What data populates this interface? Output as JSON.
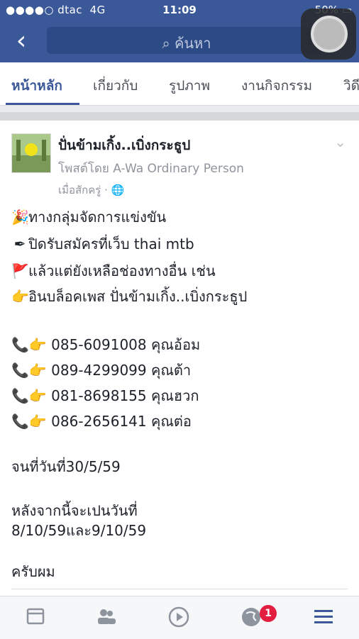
{
  "status_bar": {
    "carrier": "●●●●○ dtac",
    "network": "4G",
    "time": "11:09",
    "battery": "50%"
  },
  "header": {
    "search_placeholder": "ค้นหา",
    "back_label": "‹"
  },
  "tabs": [
    {
      "label": "หน้าหลัก",
      "active": true
    },
    {
      "label": "เกี่ยวกับ"
    },
    {
      "label": "รูปภาพ"
    },
    {
      "label": "งานกิจกรรม"
    },
    {
      "label": "วิดี"
    }
  ],
  "post": {
    "page_name": "ปั่นข้ามเกิ้ง..เบิ่งกระธูป",
    "posted_by": "โพสต์โดย A-Wa Ordinary Person",
    "time": "เมื่อสักครู่ · 🌐",
    "lines": [
      {
        "emoji": "🎉",
        "text": "ทางกลุ่มจัดการแข่งขัน"
      },
      {
        "emoji": "✒",
        "text": "ปิดรับสมัครที่เว็บ thai mtb"
      },
      {
        "emoji": "🚩",
        "text": "แล้วแต่ยังเหลือช่องทางอื่น เช่น"
      },
      {
        "emoji": "👉",
        "text": "อินบล็อคเพส ปั่นข้ามเกิ้ง..เบิ่งกระธูป"
      }
    ],
    "contacts": [
      {
        "emoji": "📞👉",
        "text": "085-6091008 คุณอ้อม"
      },
      {
        "emoji": "📞👉",
        "text": "089-4299099 คุณต้า"
      },
      {
        "emoji": "📞👉",
        "text": "081-8698155 คุณฮวก"
      },
      {
        "emoji": "📞👉",
        "text": "086-2656141 คุณต่อ"
      }
    ],
    "deadline": "จนที่วันที่30/5/59",
    "after_line1": "หลังจากนี้จะเปนวันที่",
    "after_line2": "8/10/59และ9/10/59",
    "closing": "ครับผม"
  },
  "bottom_nav": {
    "notifications_badge": "1"
  },
  "colors": {
    "brand": "#3b5998",
    "badge": "#e41e3f"
  }
}
